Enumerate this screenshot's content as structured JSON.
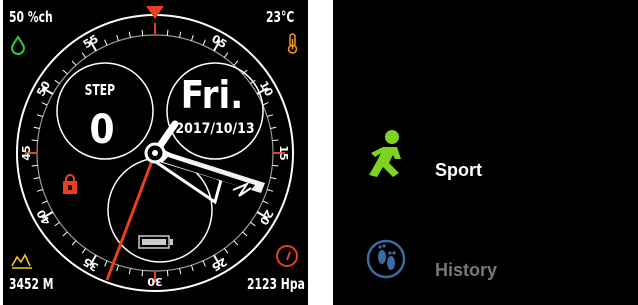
{
  "watchface": {
    "humidity": "50 %ch",
    "temperature": "23°C",
    "altitude": "3452 M",
    "pressure": "2123 Hpa",
    "step_label": "STEP",
    "step_count": "0",
    "day": "Fri.",
    "date": "2017/10/13",
    "bezel_labels": [
      "05",
      "10",
      "15",
      "20",
      "25",
      "30",
      "35",
      "40",
      "45",
      "50",
      "55"
    ]
  },
  "menu": {
    "items": [
      {
        "label": "Sport",
        "icon": "running-person-icon",
        "color": "#ffffff",
        "icon_color": "#7ed321"
      },
      {
        "label": "History",
        "icon": "footprints-icon",
        "color": "#777777",
        "icon_color": "#3b6aa6"
      }
    ]
  },
  "colors": {
    "accent_red": "#e8401c",
    "humidity_green": "#2ecc40",
    "temp_orange": "#f39c12",
    "altitude_yellow": "#f5c518"
  }
}
